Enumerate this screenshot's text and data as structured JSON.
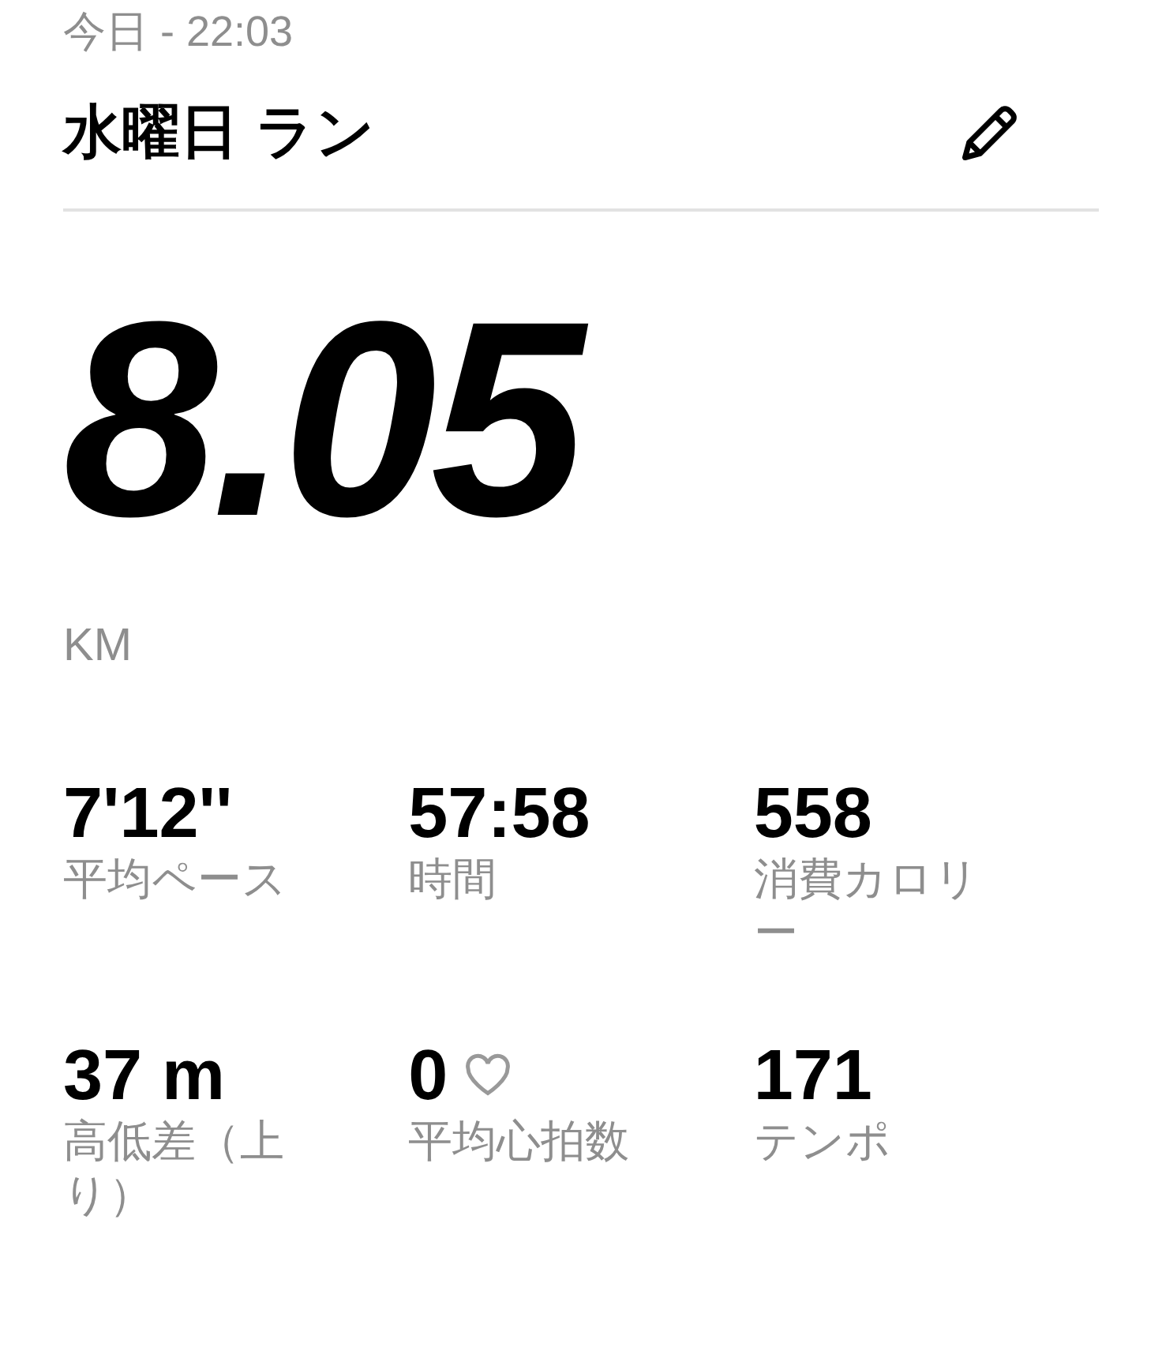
{
  "header": {
    "date": "今日 - 22:03",
    "title": "水曜日 ラン"
  },
  "distance": {
    "value": "8.05",
    "unit": "KM"
  },
  "stats": [
    {
      "value": "7'12''",
      "label": "平均ペース",
      "kind": "plain"
    },
    {
      "value": "57:58",
      "label": "時間",
      "kind": "plain"
    },
    {
      "value": "558",
      "label": "消費カロリー",
      "kind": "plain"
    },
    {
      "value": "37 m",
      "label": "高低差（上り）",
      "kind": "plain"
    },
    {
      "value": "0",
      "label": "平均心拍数",
      "kind": "heart"
    },
    {
      "value": "171",
      "label": "テンポ",
      "kind": "plain"
    }
  ]
}
